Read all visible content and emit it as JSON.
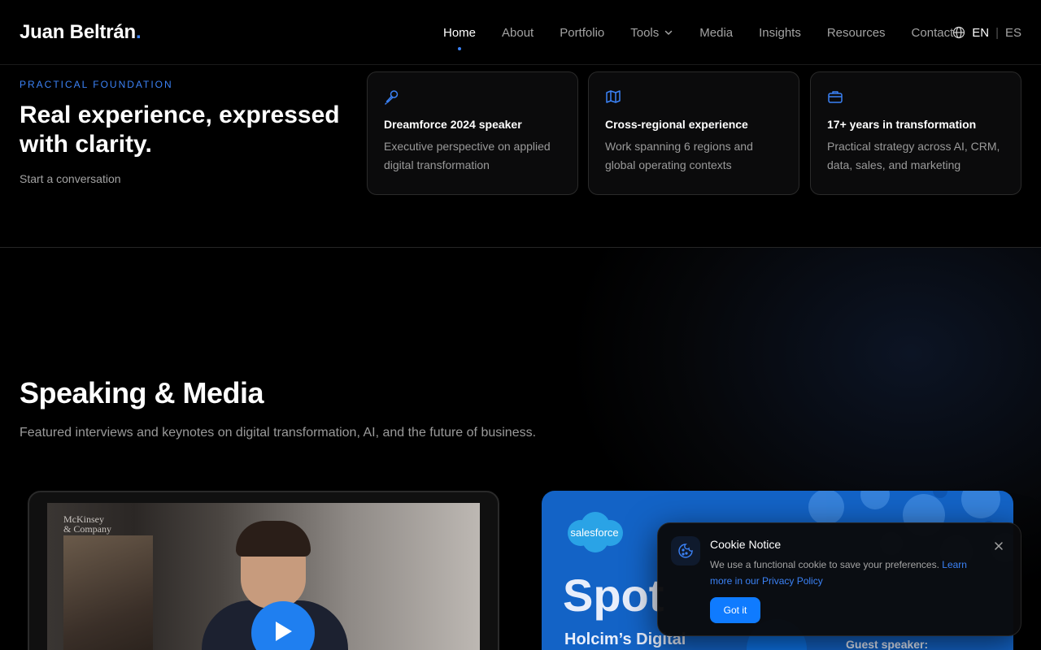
{
  "brand": {
    "name": "Juan Beltrán",
    "dot": "."
  },
  "nav": {
    "items": [
      {
        "label": "Home",
        "active": true
      },
      {
        "label": "About"
      },
      {
        "label": "Portfolio"
      },
      {
        "label": "Tools",
        "has_dropdown": true
      },
      {
        "label": "Media"
      },
      {
        "label": "Insights"
      },
      {
        "label": "Resources"
      },
      {
        "label": "Contact"
      }
    ],
    "language": {
      "icon": "globe-icon",
      "current": "EN",
      "separator": "|",
      "other": "ES"
    }
  },
  "foundation": {
    "eyebrow": "PRACTICAL FOUNDATION",
    "headline": "Real experience, expressed with clarity.",
    "cta": "Start a conversation",
    "cards": [
      {
        "icon": "microphone-icon",
        "title": "Dreamforce 2024 speaker",
        "text": "Executive perspective on applied digital transformation"
      },
      {
        "icon": "map-icon",
        "title": "Cross-regional experience",
        "text": "Work spanning 6 regions and global operating contexts"
      },
      {
        "icon": "briefcase-icon",
        "title": "17+ years in transformation",
        "text": "Practical strategy across AI, CRM, data, sales, and marketing"
      }
    ]
  },
  "media": {
    "title": "Speaking & Media",
    "subtitle": "Featured interviews and keynotes on digital transformation, AI, and the future of business.",
    "video": {
      "watermark_line1": "McKinsey",
      "watermark_line2": "& Company",
      "play_icon": "play-icon"
    },
    "spotlight": {
      "logo": "salesforce",
      "title": "Spot",
      "subtitle": "Holcim’s Digital",
      "guest": "Guest speaker:"
    }
  },
  "cookie": {
    "title": "Cookie Notice",
    "text": "We use a functional cookie to save your preferences.",
    "link": "Learn more in our Privacy Policy",
    "button": "Got it"
  },
  "colors": {
    "accent": "#3b82f6",
    "button": "#0f7bff",
    "spotlight_bg": "#1363c6",
    "background": "#000000"
  }
}
